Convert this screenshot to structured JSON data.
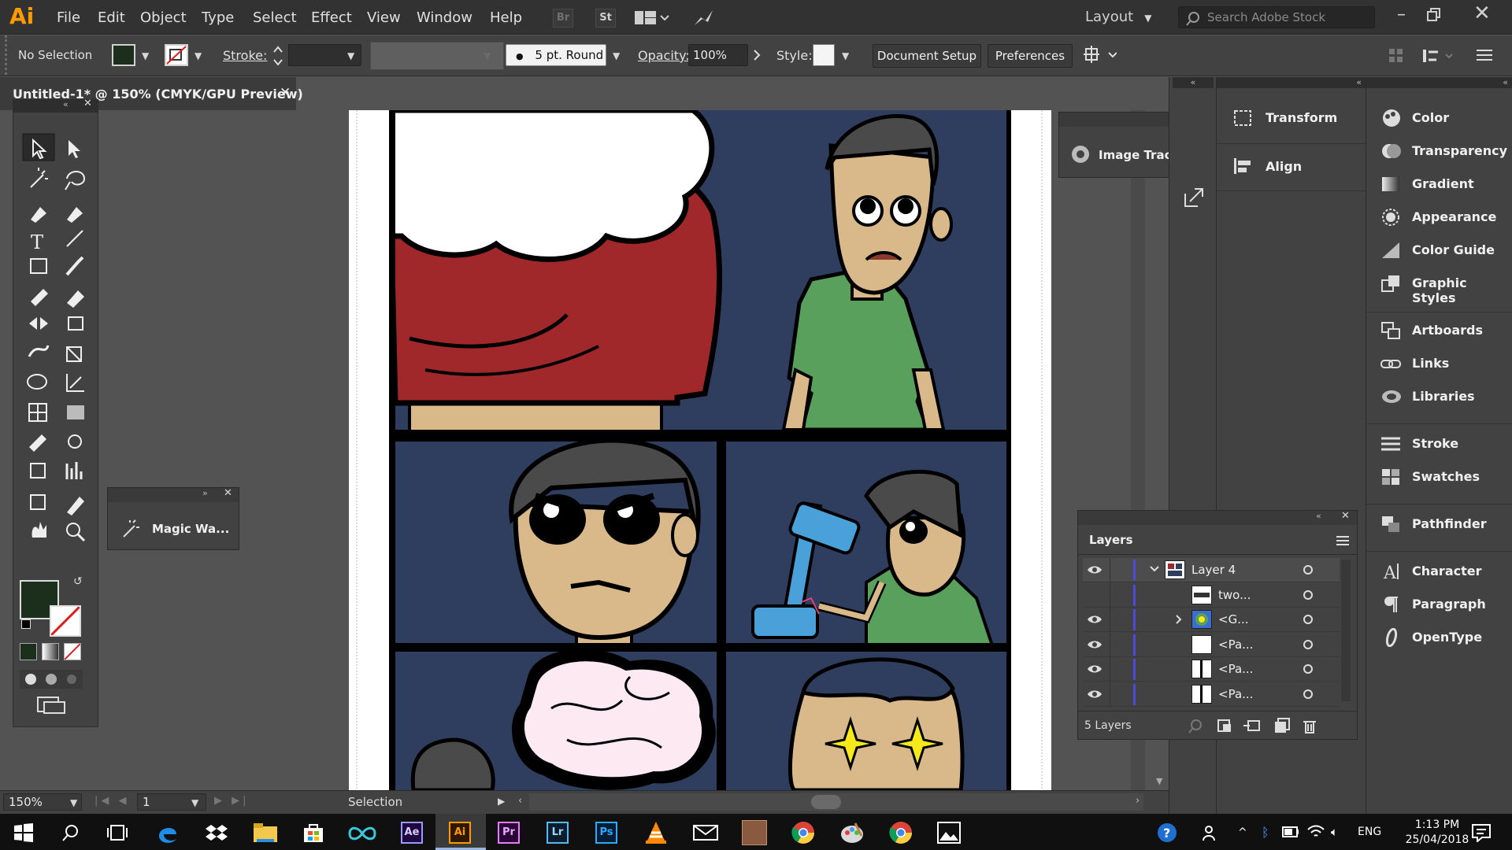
{
  "app": {
    "logo": "Ai"
  },
  "menu": [
    "File",
    "Edit",
    "Object",
    "Type",
    "Select",
    "Effect",
    "View",
    "Window",
    "Help"
  ],
  "bridge_buttons": [
    "Br",
    "St"
  ],
  "workspace": {
    "layout_label": "Layout",
    "search_placeholder": "Search Adobe Stock"
  },
  "control_bar": {
    "selection_label": "No Selection",
    "fill_color": "#1b2f1c",
    "stroke_label": "Stroke:",
    "brush_label": "5 pt. Round",
    "opacity_label": "Opacity:",
    "opacity_value": "100%",
    "style_label": "Style:",
    "document_setup": "Document Setup",
    "preferences": "Preferences"
  },
  "document": {
    "tab_title": "Untitled-1* @ 150% (CMYK/GPU Preview)"
  },
  "floating": {
    "magic_wand_label": "Magic Wa...",
    "image_trace_label": "Image Trace"
  },
  "dock": {
    "col1": [
      "Transform",
      "Align"
    ],
    "col2": [
      "Color",
      "Transparency",
      "Gradient",
      "Appearance",
      "Color Guide",
      "Graphic Styles",
      "Artboards",
      "Links",
      "Libraries",
      "Stroke",
      "Swatches",
      "Pathfinder",
      "Character",
      "Paragraph",
      "OpenType"
    ]
  },
  "layers_panel": {
    "title": "Layers",
    "rows": [
      {
        "name": "Layer 4",
        "visible": true,
        "expanded": true
      },
      {
        "name": "two...",
        "visible": false
      },
      {
        "name": "<G...",
        "visible": true,
        "collapsed_group": true
      },
      {
        "name": "<Pa...",
        "visible": true
      },
      {
        "name": "<Pa...",
        "visible": true
      },
      {
        "name": "<Pa...",
        "visible": true
      }
    ],
    "count_label": "5 Layers"
  },
  "status": {
    "zoom": "150%",
    "artboard_number": "1",
    "tool_label": "Selection"
  },
  "taskbar": {
    "language": "ENG",
    "time": "1:13 PM",
    "date": "25/04/2018"
  },
  "colors": {
    "accent": "#ff9a00",
    "panel_bg": "#424242",
    "comic_navy": "#2f3e5e",
    "shirt_green": "#58a05b",
    "skin": "#d9b98a",
    "hair": "#4a4a4a",
    "cloud_red": "#a0282b"
  }
}
